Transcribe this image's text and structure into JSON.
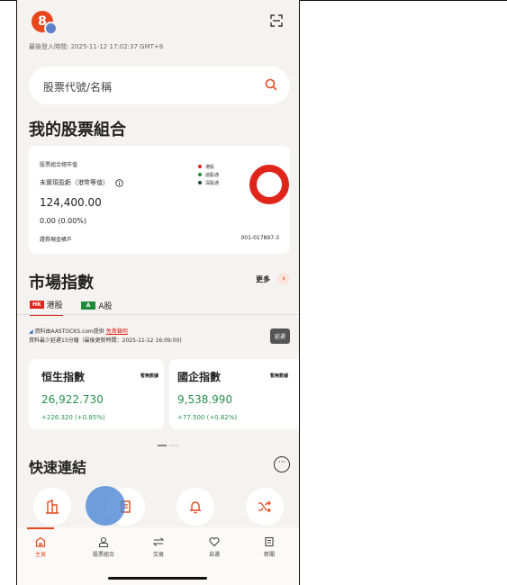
{
  "avatar": {
    "initial": "8"
  },
  "last_login": "最後登入時間: 2025-11-12 17:02:37 GMT+8",
  "search": {
    "placeholder": "股票代號/名稱"
  },
  "portfolio": {
    "title": "我的股票組合",
    "market_value_label": "股票組合總市值",
    "unrealized_label": "未實現盈虧（港幣等值）",
    "value": "124,400.00",
    "change": "0.00 (0.00%)",
    "account_label": "證券現金帳戶",
    "account_no": "001-017897-3",
    "legend": [
      {
        "label": "港股",
        "color": "#e0251b"
      },
      {
        "label": "滬股通",
        "color": "#1f8a3c"
      },
      {
        "label": "深股通",
        "color": "#1b4d2b"
      }
    ]
  },
  "indices": {
    "title": "市場指數",
    "more_label": "更多",
    "tabs": [
      {
        "badge": "HK",
        "label": "港股",
        "badge_color": "#e0251b"
      },
      {
        "badge": "A",
        "label": "A股",
        "badge_color": "#1f8a3c"
      }
    ],
    "source_prefix": "資料由AASTOCKS.com提供",
    "disclaimer": "免責聲明",
    "delay_note": "資料最少延遲15分鐘（最後更新時間：2025-11-12 16:09:00)",
    "delay_badge": "延遲",
    "cards": [
      {
        "name": "恒生指數",
        "status": "暫無數據",
        "value": "26,922.730",
        "change": "+226.320 (+0.85%)"
      },
      {
        "name": "國企指數",
        "status": "暫無數據",
        "value": "9,538.990",
        "change": "+77.500 (+0.82%)"
      }
    ]
  },
  "quick_links": {
    "title": "快速連結"
  },
  "bottom_nav": [
    {
      "label": "主頁",
      "icon": "home-icon",
      "active": true
    },
    {
      "label": "股票組合",
      "icon": "user-icon",
      "active": false
    },
    {
      "label": "交易",
      "icon": "swap-icon",
      "active": false
    },
    {
      "label": "自選",
      "icon": "heart-icon",
      "active": false
    },
    {
      "label": "新聞",
      "icon": "news-icon",
      "active": false
    }
  ],
  "colors": {
    "accent": "#e8471c",
    "green": "#24914a",
    "red": "#e0251b"
  }
}
